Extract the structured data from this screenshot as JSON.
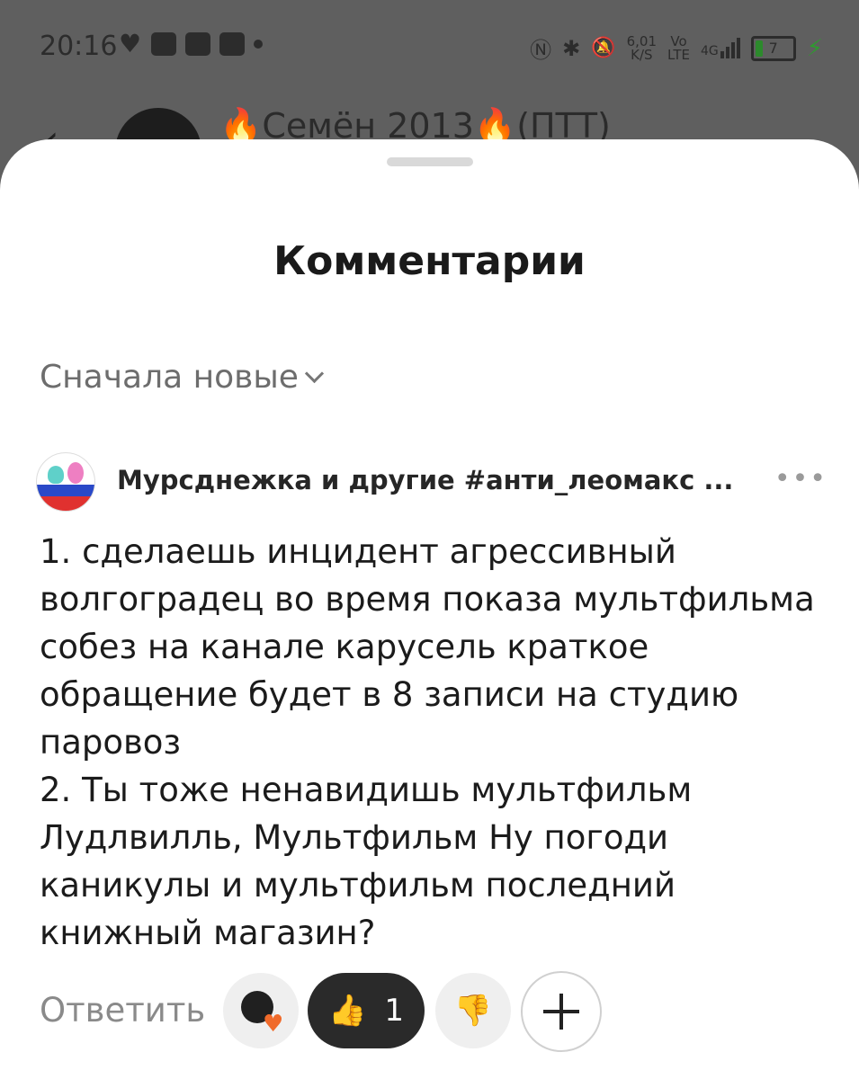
{
  "status_bar": {
    "time": "20:16",
    "speed_value": "6,01",
    "speed_unit": "K/S",
    "volte_top": "Vo",
    "volte_bottom": "LTE",
    "network": "4G",
    "battery": "7",
    "icons": [
      "heart-icon",
      "app-icon",
      "app-icon",
      "app-icon",
      "nfc-icon",
      "bluetooth-icon",
      "mute-icon",
      "signal-icon",
      "battery-icon",
      "charging-icon"
    ]
  },
  "background_header": {
    "title": "🔥Семён 2013🔥(ПТТ)"
  },
  "sheet": {
    "title": "Комментарии",
    "sort_label": "Сначала новые"
  },
  "comment": {
    "author": "Мурсднежка и другие #анти_леомакс ...",
    "more": "•••",
    "text": "1. сделаешь инцидент агрессивный волгоградец во время показа мультфильма собез на канале карусель краткое обращение будет в 8 записи на студию паровоз\n2. Ты тоже ненавидишь мультфильм Лудлвилль, Мультфильм Ну погоди каникулы и мультфильм последний книжный магазин?",
    "reply_label": "Ответить",
    "like_count": "1",
    "like_icon": "👍",
    "dislike_icon": "👎"
  },
  "colors": {
    "like_pill": "#2a2a2a",
    "charging": "#2f9a2f",
    "reaction_heart": "#f06a2a"
  }
}
